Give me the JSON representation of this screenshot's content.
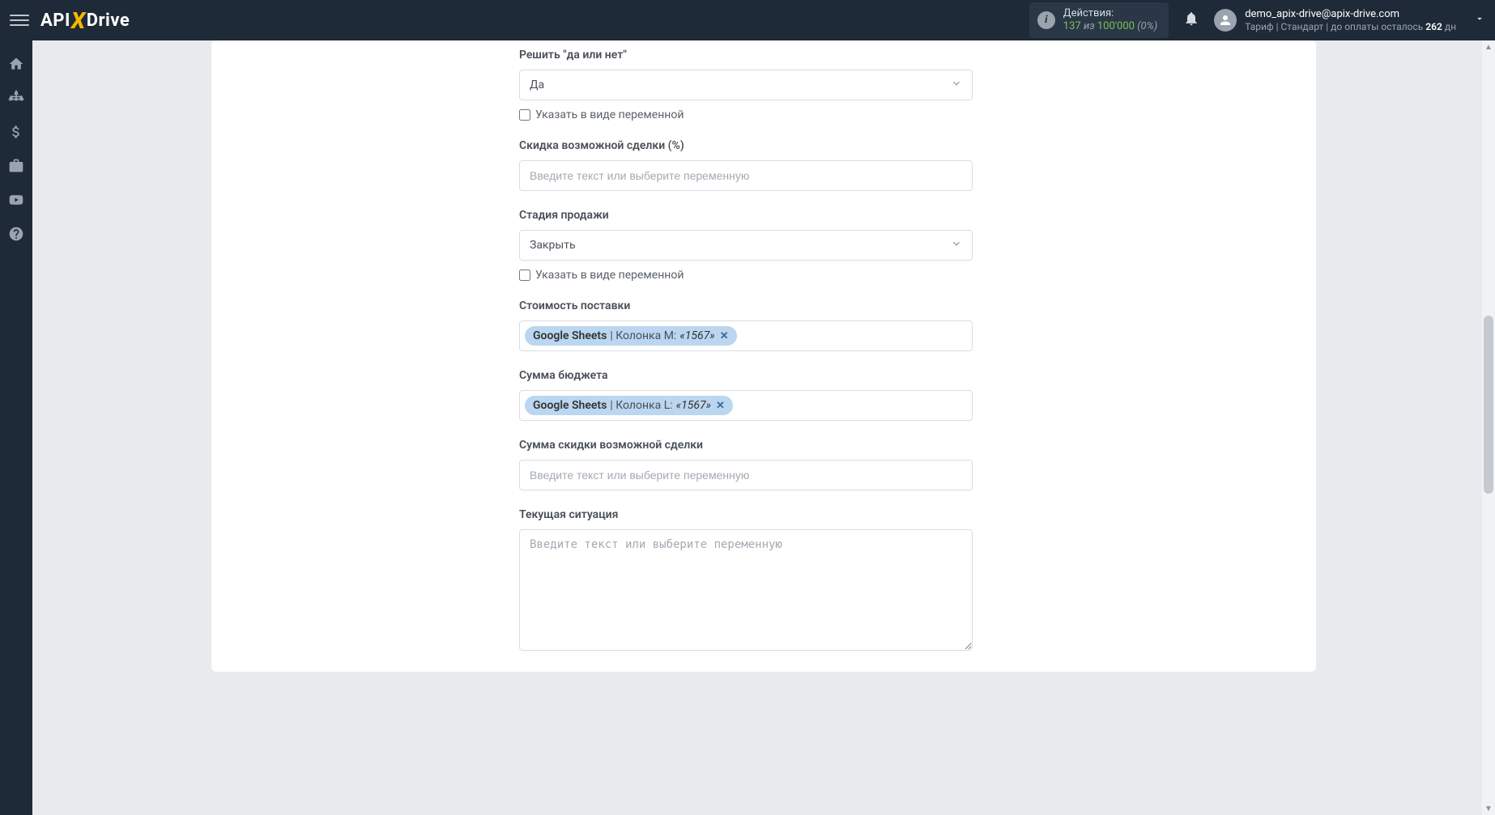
{
  "header": {
    "logo": {
      "api": "API",
      "x": "X",
      "drive": "Drive"
    },
    "actions": {
      "label": "Действия:",
      "used": "137",
      "of_word": "из",
      "limit": "100'000",
      "percent": "(0%)"
    },
    "user": {
      "email": "demo_apix-drive@apix-drive.com",
      "plan_prefix": "Тариф | Стандарт | до оплаты осталось ",
      "days": "262",
      "days_suffix": " дн"
    }
  },
  "form": {
    "placeholder_text": "Введите текст или выберите переменную",
    "variable_checkbox": "Указать в виде переменной",
    "fields": {
      "decide": {
        "label": "Решить \"да или нет\"",
        "value": "Да"
      },
      "discount_pct": {
        "label": "Скидка возможной сделки (%)"
      },
      "sale_stage": {
        "label": "Стадия продажи",
        "value": "Закрыть"
      },
      "delivery_cost": {
        "label": "Стоимость поставки",
        "token": {
          "src": "Google Sheets",
          "col": " | Колонка M: ",
          "val": "«1567»"
        }
      },
      "budget_sum": {
        "label": "Сумма бюджета",
        "token": {
          "src": "Google Sheets",
          "col": " | Колонка L: ",
          "val": "«1567»"
        }
      },
      "discount_sum": {
        "label": "Сумма скидки возможной сделки"
      },
      "current_situation": {
        "label": "Текущая ситуация"
      }
    }
  }
}
